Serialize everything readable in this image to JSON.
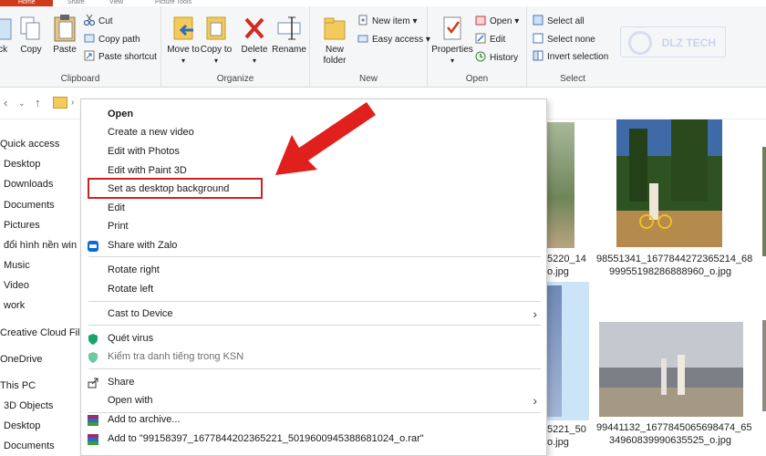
{
  "tabs": {
    "home": "Home",
    "share": "Share",
    "view": "View",
    "picture_tools": "Picture Tools"
  },
  "ribbon": {
    "clipboard": {
      "label": "Clipboard",
      "quick_access_partial": "ick",
      "copy": "Copy",
      "paste": "Paste",
      "cut": "Cut",
      "copy_path": "Copy path",
      "paste_shortcut": "Paste shortcut"
    },
    "organize": {
      "label": "Organize",
      "move_to": "Move to",
      "copy_to": "Copy to",
      "delete": "Delete",
      "rename": "Rename"
    },
    "new": {
      "label": "New",
      "new_folder": "New folder",
      "new_item": "New item",
      "easy_access": "Easy access"
    },
    "open": {
      "label": "Open",
      "properties": "Properties",
      "open": "Open",
      "edit": "Edit",
      "history": "History"
    },
    "select": {
      "label": "Select",
      "select_all": "Select all",
      "select_none": "Select none",
      "invert_selection": "Invert selection"
    },
    "watermark": "DLZ TECH"
  },
  "navpane": {
    "items": [
      "Quick access",
      "Desktop",
      "Downloads",
      "Documents",
      "Pictures",
      "đổi hình nền win",
      "Music",
      "Video",
      "work",
      "Creative Cloud File",
      "OneDrive",
      "This PC",
      "3D Objects",
      "Desktop",
      "Documents"
    ]
  },
  "files": [
    {
      "line1": "5220_14",
      "line2": "o.jpg"
    },
    {
      "line1": "98551341_1677844272365214_68",
      "line2": "99955198286888960_o.jpg"
    },
    {
      "line1": "5221_50",
      "line2": "o.jpg"
    },
    {
      "line1": "99441132_1677845065698474_65",
      "line2": "34960839990635525_o.jpg"
    }
  ],
  "menu": {
    "open": "Open",
    "create_video": "Create a new video",
    "edit_photos": "Edit with Photos",
    "edit_paint3d": "Edit with Paint 3D",
    "set_background": "Set as desktop background",
    "edit": "Edit",
    "print": "Print",
    "share_zalo": "Share with Zalo",
    "rotate_right": "Rotate right",
    "rotate_left": "Rotate left",
    "cast": "Cast to Device",
    "scan_virus": "Quét virus",
    "check_ksn": "Kiểm tra danh tiếng trong KSN",
    "share": "Share",
    "open_with": "Open with",
    "add_archive": "Add to archive...",
    "add_rar": "Add to \"99158397_1677844202365221_5019600945388681024_o.rar\""
  },
  "colors": {
    "accent_red": "#d4201c",
    "selection_blue": "#cce4f7"
  }
}
